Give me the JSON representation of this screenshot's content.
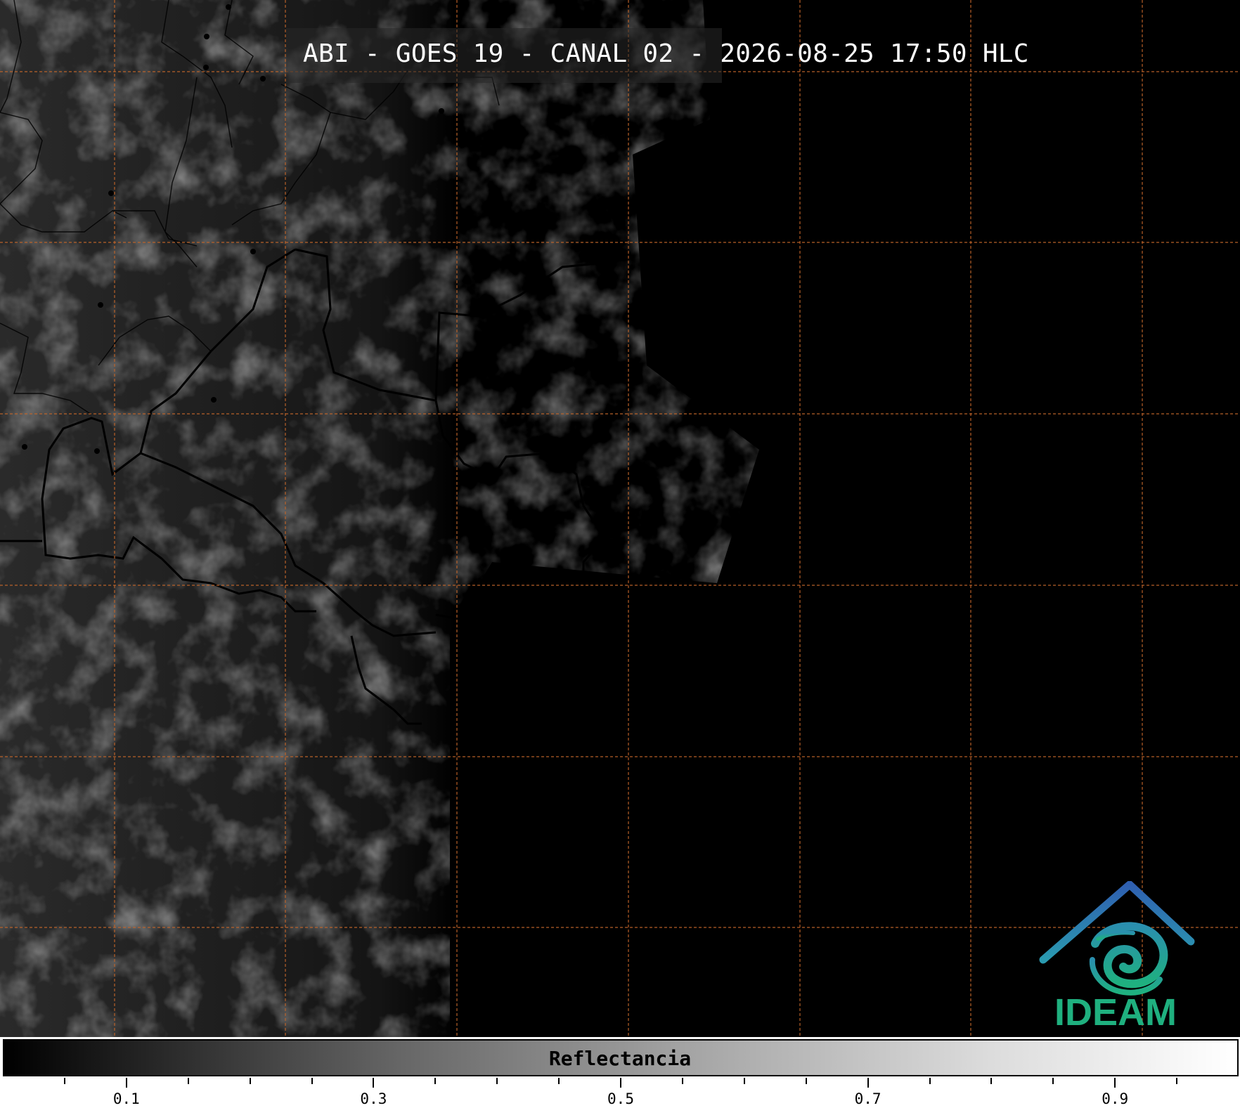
{
  "title": "ABI - GOES 19 - CANAL 02 - 2026-08-25 17:50 HLC",
  "map": {
    "graticule_color": "#c0652a",
    "basemap": "satellite-visible-reflectance",
    "border_color": "#000000"
  },
  "colorbar": {
    "label": "Reflectancia",
    "range": [
      0.0,
      1.0
    ],
    "colors": [
      "#000000",
      "#ffffff"
    ],
    "major_ticks": [
      {
        "value": 0.1,
        "label": "0.1"
      },
      {
        "value": 0.3,
        "label": "0.3"
      },
      {
        "value": 0.5,
        "label": "0.5"
      },
      {
        "value": 0.7,
        "label": "0.7"
      },
      {
        "value": 0.9,
        "label": "0.9"
      }
    ],
    "minor_step": 0.05
  },
  "logo": {
    "text": "IDEAM",
    "colors": {
      "roof": "#2f6fb5",
      "swirl": "#1fa88a",
      "text": "#1fb07f"
    }
  }
}
